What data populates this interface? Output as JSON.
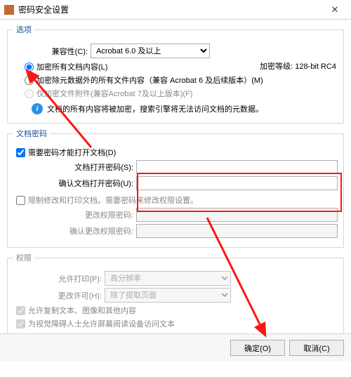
{
  "window": {
    "title": "密码安全设置"
  },
  "options": {
    "legend": "选项",
    "compat_label": "兼容性(C):",
    "compat_value": "Acrobat 6.0 及以上",
    "enc_level_label": "加密等级:",
    "enc_level_value": "128-bit RC4",
    "radio_all": "加密所有文档内容(L)",
    "radio_except": "加密除元数据外的所有文件内容（兼容 Acrobat 6 及后续版本）(M)",
    "radio_attach": "仅加密文件附件(兼容Acrobat 7及以上版本)(F)",
    "info_text": "文档的所有内容将被加密，搜索引擎将无法访问文档的元数据。"
  },
  "docpass": {
    "legend": "文档密码",
    "check_open": "需要密码才能打开文档(D)",
    "open_label": "文档打开密码(S):",
    "confirm_label": "确认文档打开密码(U):"
  },
  "perm_section": {
    "check_restrict": "限制修改和打印文档。需要密码来修改权限设置。",
    "change_pw_label": "更改权限密码:",
    "confirm_change_label": "确认更改权限密码:"
  },
  "permissions": {
    "legend": "权限",
    "print_label": "允许打印(P):",
    "print_value": "高分辨率",
    "change_label": "更改许可(H):",
    "change_value": "除了提取页面",
    "check_copy": "允许复制文本、图像和其他内容",
    "check_access": "为视觉障碍人士允许屏幕阅读设备访问文本"
  },
  "footer": {
    "ok": "确定(O)",
    "cancel": "取消(C)"
  }
}
